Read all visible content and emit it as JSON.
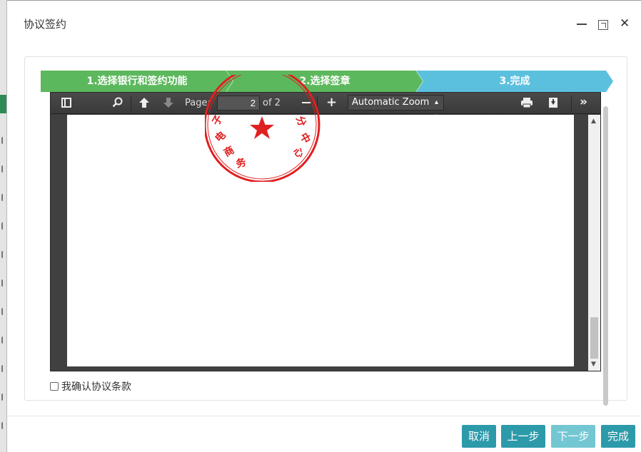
{
  "dialog": {
    "title": "协议签约"
  },
  "steps": [
    {
      "label": "1.选择银行和签约功能",
      "status": "complete",
      "color": "#5cb85c"
    },
    {
      "label": "2.选择签章",
      "status": "complete",
      "color": "#5cb85c"
    },
    {
      "label": "3.完成",
      "status": "active",
      "color": "#5bc0de"
    }
  ],
  "pdf_toolbar": {
    "page_label": "Page:",
    "page_value": "2",
    "page_total": "of 2",
    "zoom_value": "Automatic Zoom",
    "icons": [
      "sidebar-toggle-icon",
      "search-icon",
      "previous-page-icon",
      "next-page-icon",
      "zoom-out-icon",
      "zoom-in-icon",
      "print-icon",
      "download-icon",
      "tools-icon"
    ]
  },
  "seal": {
    "color": "#e02020",
    "text_chars": [
      "子",
      "电",
      "商",
      "务",
      "分",
      "中",
      "心"
    ]
  },
  "confirm": {
    "label": "我确认协议条款",
    "checked": false
  },
  "footer": {
    "cancel": "取消",
    "prev": "上一步",
    "next": "下一步",
    "done": "完成"
  },
  "colors": {
    "primary_button": "#2d9aaa",
    "disabled_button": "#73c7d2",
    "viewer_bg": "#404040"
  }
}
